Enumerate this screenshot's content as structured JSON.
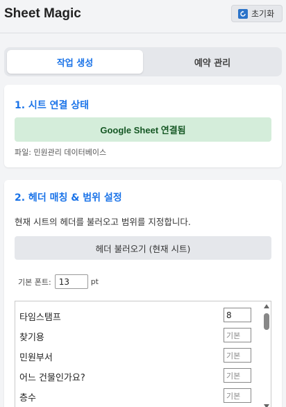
{
  "header": {
    "title": "Sheet Magic",
    "reset_label": "초기화",
    "reset_icon": "refresh-icon"
  },
  "tabs": [
    {
      "label": "작업 생성",
      "active": true
    },
    {
      "label": "예약 관리",
      "active": false
    }
  ],
  "connection": {
    "title": "1. 시트 연결 상태",
    "status": "Google Sheet 연결됨",
    "status_color": "#d4edda",
    "file_line": "파일: 민원관리 데이터베이스"
  },
  "header_mapping": {
    "title": "2. 헤더 매칭 & 범위 설정",
    "description": "현재 시트의 헤더를 불러오고 범위를 지정합니다.",
    "load_button": "헤더 불러오기 (현재 시트)",
    "font_label": "기본 폰트:",
    "font_value": "13",
    "font_unit": "pt",
    "rows": [
      {
        "label": "타임스탬프",
        "value": "8"
      },
      {
        "label": "찾기용",
        "value": "기본"
      },
      {
        "label": "민원부서",
        "value": "기본"
      },
      {
        "label": "어느 건물인가요?",
        "value": "기본"
      },
      {
        "label": "층수",
        "value": "기본"
      }
    ]
  },
  "colors": {
    "accent": "#1a73e8",
    "success_bg": "#d4edda",
    "success_text": "#155724"
  }
}
